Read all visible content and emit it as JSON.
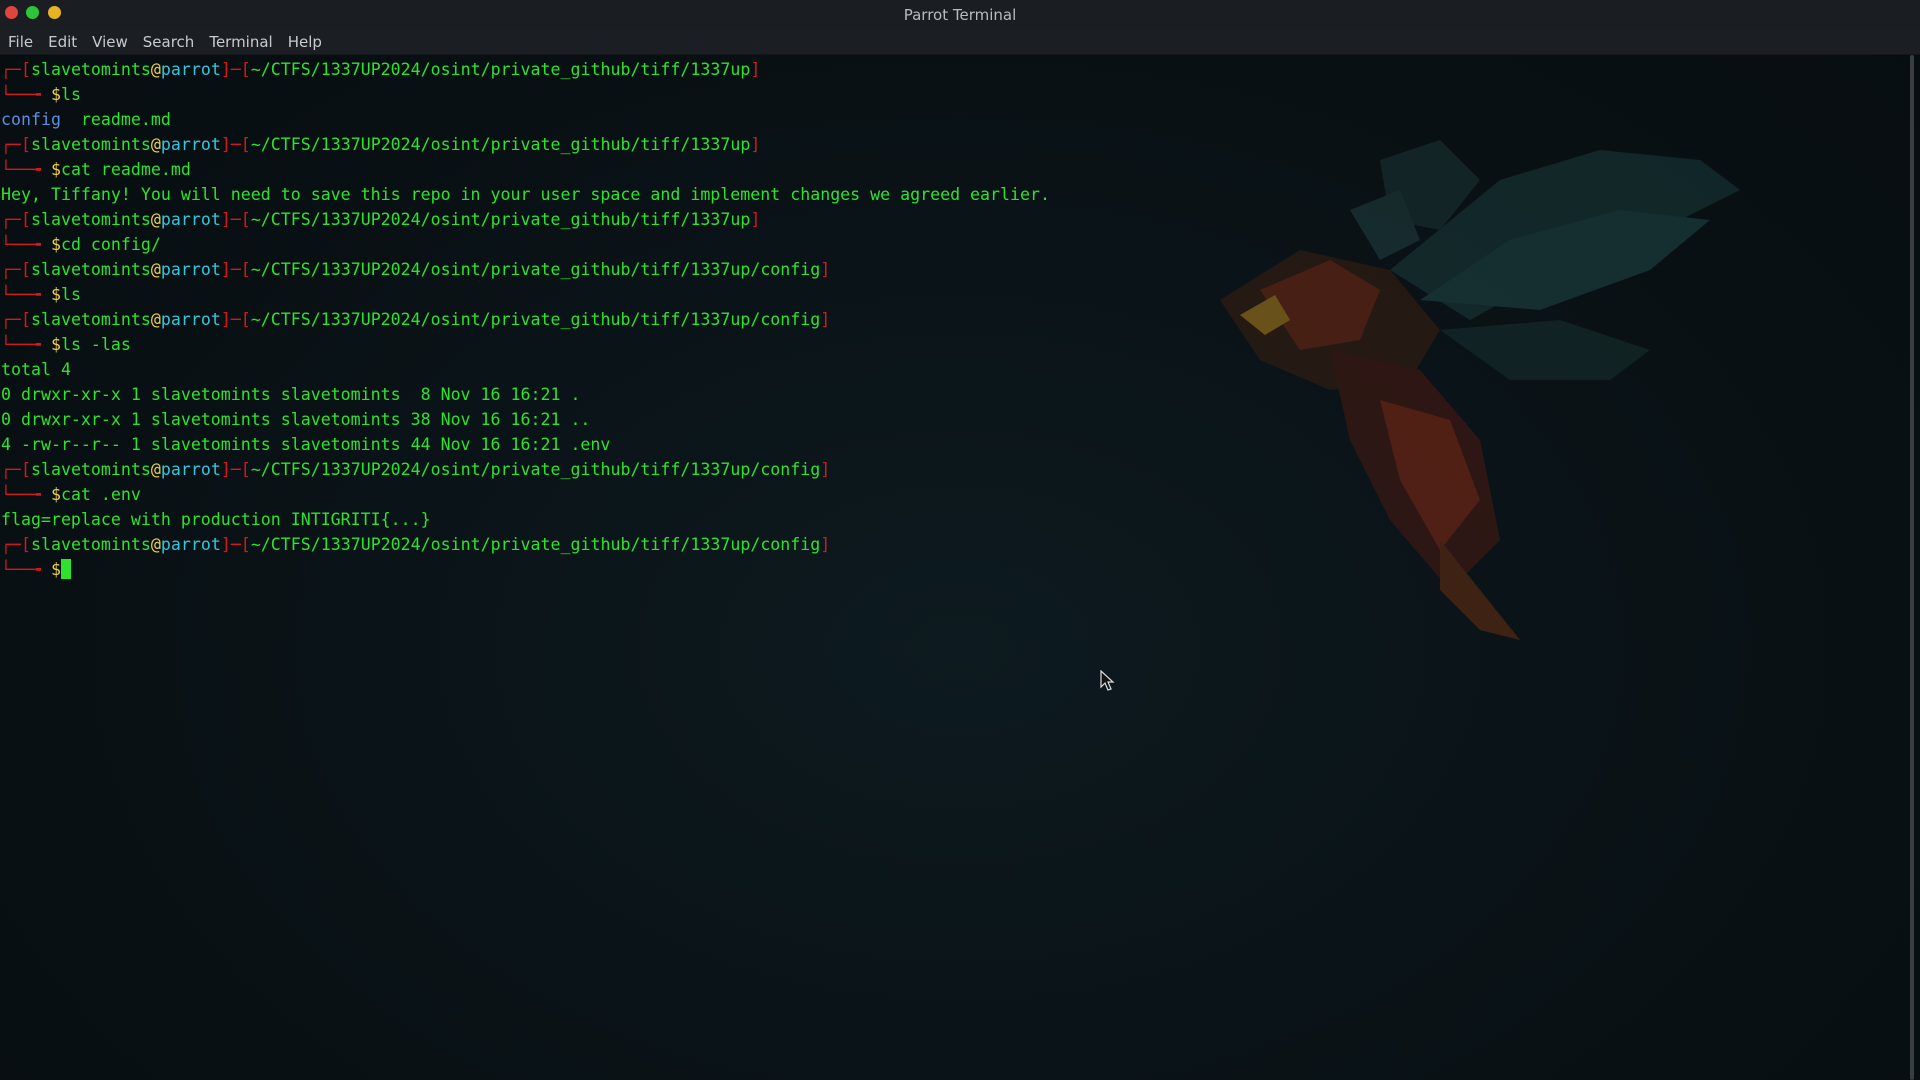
{
  "window": {
    "title": "Parrot Terminal"
  },
  "menu": [
    "File",
    "Edit",
    "View",
    "Search",
    "Terminal",
    "Help"
  ],
  "colors": {
    "close": "#e0443e",
    "minimize": "#2ec53a",
    "maximize": "#e8b423",
    "accent_green": "#2ee22e",
    "prompt_red": "#d3191c",
    "host_cyan": "#34c6d9"
  },
  "prompt": {
    "user": "slavetomints",
    "at": "@",
    "host": "parrot"
  },
  "blocks": [
    {
      "path": "~/CTFS/1337UP2024/osint/private_github/tiff/1337up",
      "cmd": "ls",
      "output": [],
      "ls_output": [
        "config",
        "readme.md"
      ]
    },
    {
      "path": "~/CTFS/1337UP2024/osint/private_github/tiff/1337up",
      "cmd": "cat readme.md",
      "output": [
        "Hey, Tiffany! You will need to save this repo in your user space and implement changes we agreed earlier."
      ]
    },
    {
      "path": "~/CTFS/1337UP2024/osint/private_github/tiff/1337up",
      "cmd": "cd config/",
      "output": []
    },
    {
      "path": "~/CTFS/1337UP2024/osint/private_github/tiff/1337up/config",
      "cmd": "ls",
      "output": []
    },
    {
      "path": "~/CTFS/1337UP2024/osint/private_github/tiff/1337up/config",
      "cmd": "ls -las",
      "output": [
        "total 4",
        "0 drwxr-xr-x 1 slavetomints slavetomints  8 Nov 16 16:21 .",
        "0 drwxr-xr-x 1 slavetomints slavetomints 38 Nov 16 16:21 ..",
        "4 -rw-r--r-- 1 slavetomints slavetomints 44 Nov 16 16:21 .env"
      ]
    },
    {
      "path": "~/CTFS/1337UP2024/osint/private_github/tiff/1337up/config",
      "cmd": "cat .env",
      "output": [
        "flag=replace with production INTIGRITI{...}"
      ]
    },
    {
      "path": "~/CTFS/1337UP2024/osint/private_github/tiff/1337up/config",
      "cmd": "",
      "output": [],
      "active": true
    }
  ]
}
